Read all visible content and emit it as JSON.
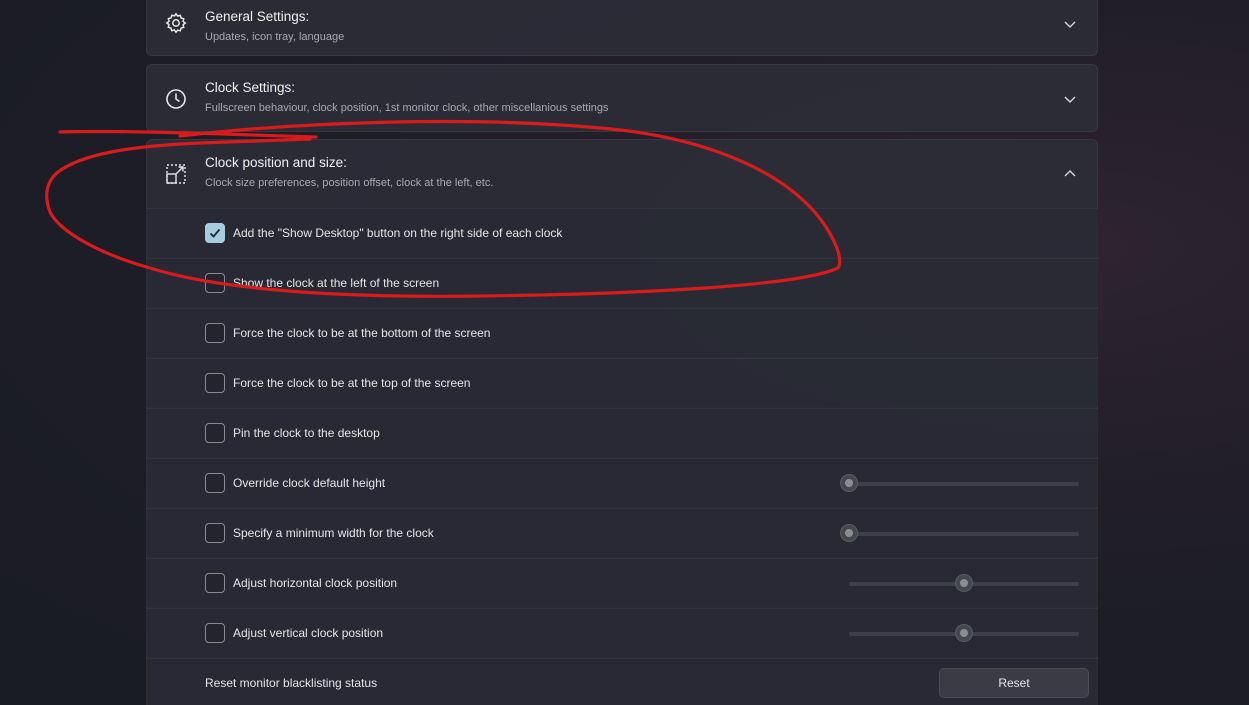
{
  "sections": [
    {
      "icon": "gear-icon",
      "title": "General Settings:",
      "subtitle": "Updates, icon tray, language",
      "expanded": false
    },
    {
      "icon": "clock-icon",
      "title": "Clock Settings:",
      "subtitle": "Fullscreen behaviour, clock position, 1st monitor clock, other miscellanious settings",
      "expanded": false
    },
    {
      "icon": "resize-icon",
      "title": "Clock position and size:",
      "subtitle": "Clock size preferences, position offset, clock at the left, etc.",
      "expanded": true
    }
  ],
  "options": [
    {
      "label": "Add the \"Show Desktop\" button on the right side of each clock",
      "checked": true
    },
    {
      "label": "Show the clock at the left of the screen",
      "checked": false
    },
    {
      "label": "Force the clock to be at the bottom of the screen",
      "checked": false
    },
    {
      "label": "Force the clock to be at the top of the screen",
      "checked": false
    },
    {
      "label": "Pin the clock to the desktop",
      "checked": false
    },
    {
      "label": "Override clock default height",
      "checked": false,
      "slider": 0.0
    },
    {
      "label": "Specify a minimum width for the clock",
      "checked": false,
      "slider": 0.0
    },
    {
      "label": "Adjust horizontal clock position",
      "checked": false,
      "slider": 0.5
    },
    {
      "label": "Adjust vertical clock position",
      "checked": false,
      "slider": 0.5
    }
  ],
  "reset": {
    "label": "Reset monitor blacklisting status",
    "button": "Reset"
  },
  "colors": {
    "accent": "#a6cce0",
    "annotation": "#d81b1b"
  }
}
